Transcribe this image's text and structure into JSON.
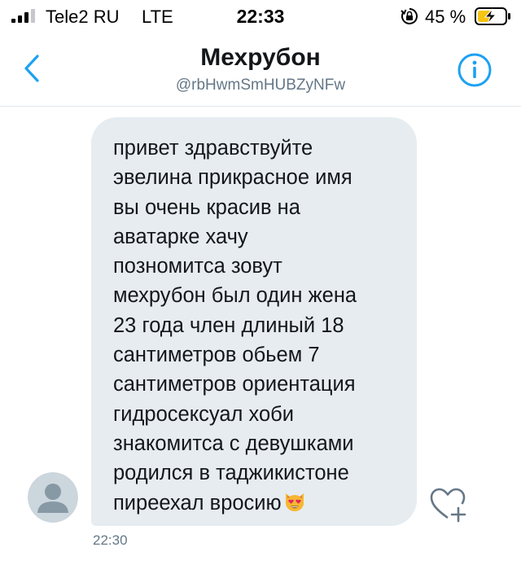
{
  "status_bar": {
    "carrier": "Tele2 RU",
    "network": "LTE",
    "time": "22:33",
    "battery_percent": "45 %",
    "icons": [
      "signal-icon",
      "orientation-lock-icon",
      "battery-charging-icon"
    ]
  },
  "header": {
    "title": "Мехрубон",
    "handle": "@rbHwmSmHUBZyNFw",
    "icons": [
      "chevron-left-icon",
      "info-icon"
    ]
  },
  "message": {
    "lines": [
      "привет здравствуйте",
      "эвелина прикрасное имя",
      "вы очень красив на",
      "аватарке хачу",
      "позномитса зовут",
      "мехрубон был один жена",
      "23 года член длиный 18",
      "сантиметров обьем 7",
      "сантиметров ориентация",
      "гидросексуал хоби",
      "знакомитса с девушками",
      "родился в таджикистоне",
      "пиреехал вросию"
    ],
    "emoji": "smiling-cat-heart-eyes-emoji",
    "time": "22:30"
  },
  "colors": {
    "accent": "#1da1f2",
    "bubble": "#e6ecf0",
    "text": "#14171a",
    "secondary_text": "#657786",
    "avatar_bg": "#ccd6dd",
    "avatar_fg": "#8899a6"
  }
}
